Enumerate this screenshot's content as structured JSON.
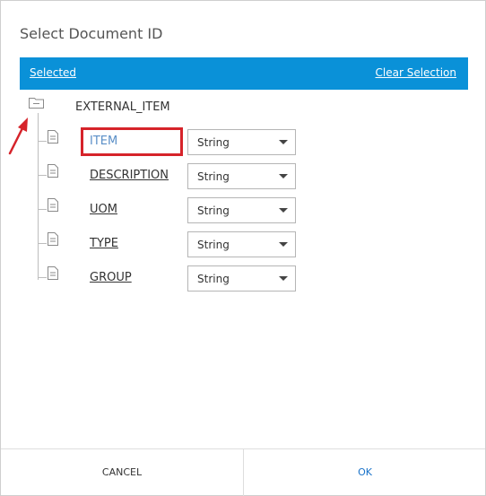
{
  "dialog": {
    "title": "Select Document ID",
    "header": {
      "selected_label": "Selected",
      "clear_label": "Clear Selection"
    },
    "tree": {
      "root_label": "EXTERNAL_ITEM",
      "fields": [
        {
          "name": "ITEM",
          "type": "String"
        },
        {
          "name": "DESCRIPTION",
          "type": "String"
        },
        {
          "name": "UOM",
          "type": "String"
        },
        {
          "name": "TYPE",
          "type": "String"
        },
        {
          "name": "GROUP",
          "type": "String"
        }
      ]
    },
    "footer": {
      "cancel_label": "CANCEL",
      "ok_label": "OK"
    }
  },
  "colors": {
    "header": "#0a91d8",
    "highlight": "#d6232a",
    "ok": "#1a73c9"
  },
  "icons": [
    "folder-icon",
    "document-icon",
    "chevron-down-icon",
    "red-arrow-annotation"
  ]
}
